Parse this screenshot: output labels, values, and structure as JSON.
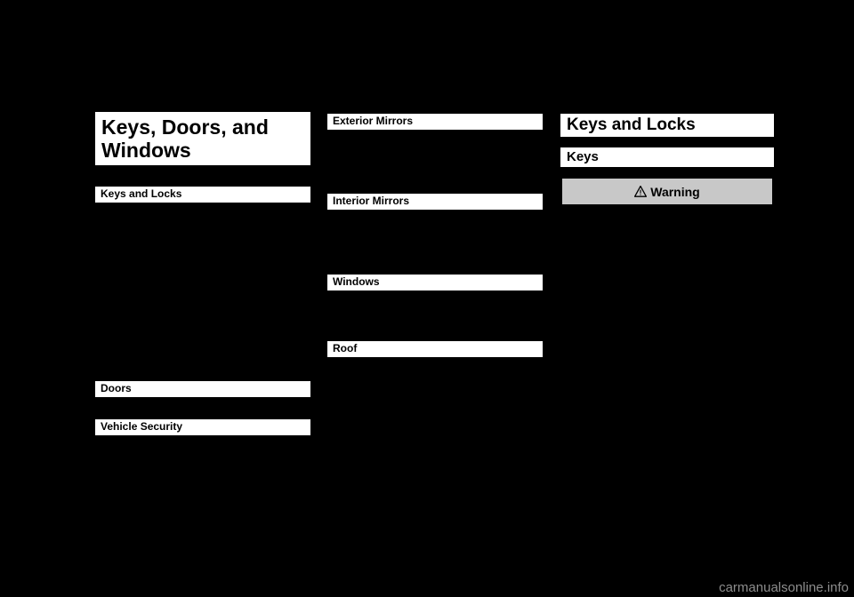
{
  "page": {
    "background_color": "#000000",
    "text_on_bar_color": "#000000",
    "bar_color": "#ffffff",
    "warning_box_color": "#c8c8c8"
  },
  "column1": {
    "chapter_title_line1": "Keys, Doors, and",
    "chapter_title_line2": "Windows",
    "sections": [
      {
        "label": "Keys and Locks"
      },
      {
        "label": "Doors"
      },
      {
        "label": "Vehicle Security"
      }
    ]
  },
  "column2": {
    "sections": [
      {
        "label": "Exterior Mirrors"
      },
      {
        "label": "Interior Mirrors"
      },
      {
        "label": "Windows"
      },
      {
        "label": "Roof"
      }
    ]
  },
  "column3": {
    "title": "Keys and Locks",
    "subsection": "Keys",
    "warning": {
      "icon": "warning-triangle-icon",
      "label": "Warning"
    }
  },
  "footer": {
    "watermark": "carmanualsonline.info"
  }
}
